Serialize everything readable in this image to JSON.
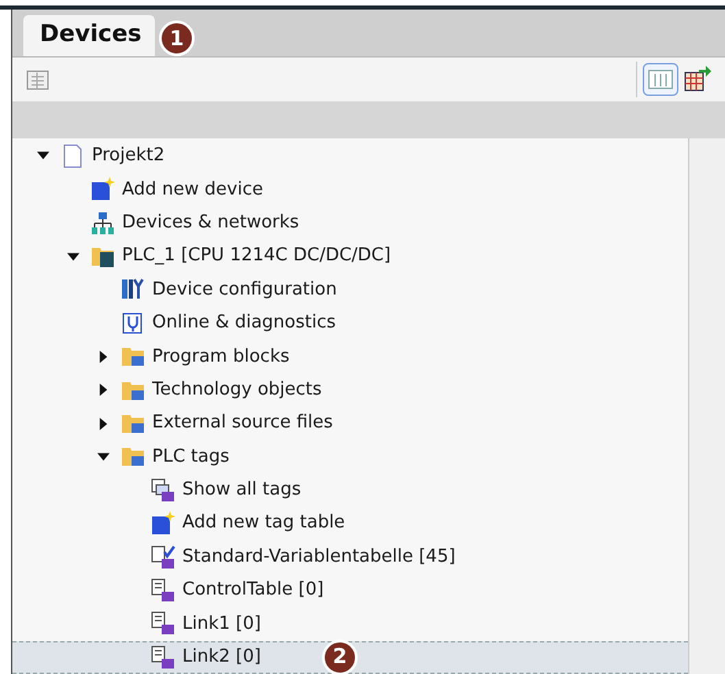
{
  "tab": {
    "label": "Devices",
    "selected": true,
    "callout": "1"
  },
  "tree": [
    {
      "label": "Projekt2",
      "kind": "project",
      "expanded": true,
      "selected": false,
      "children": [
        {
          "label": "Add new device",
          "kind": "add",
          "selected": false
        },
        {
          "label": "Devices & networks",
          "kind": "network",
          "selected": false
        },
        {
          "label": "PLC_1 [CPU 1214C DC/DC/DC]",
          "kind": "plc",
          "expanded": true,
          "selected": false,
          "children": [
            {
              "label": "Device configuration",
              "kind": "config",
              "selected": false
            },
            {
              "label": "Online & diagnostics",
              "kind": "diagnostics",
              "selected": false
            },
            {
              "label": "Program blocks",
              "kind": "folder",
              "expanded": false,
              "selected": false
            },
            {
              "label": "Technology objects",
              "kind": "folder",
              "expanded": false,
              "selected": false
            },
            {
              "label": "External source files",
              "kind": "folder",
              "expanded": false,
              "selected": false
            },
            {
              "label": "PLC tags",
              "kind": "folder",
              "expanded": true,
              "selected": false,
              "children": [
                {
                  "label": "Show all tags",
                  "kind": "tags",
                  "selected": false
                },
                {
                  "label": "Add new tag table",
                  "kind": "add",
                  "selected": false
                },
                {
                  "label": "Standard-Variablentabelle [45]",
                  "kind": "tagtable-check",
                  "selected": false
                },
                {
                  "label": "ControlTable [0]",
                  "kind": "tagtable",
                  "selected": false
                },
                {
                  "label": "Link1 [0]",
                  "kind": "tagtable",
                  "selected": false
                },
                {
                  "label": "Link2 [0]",
                  "kind": "tagtable",
                  "selected": true,
                  "callout": "2"
                }
              ]
            }
          ]
        }
      ]
    }
  ]
}
